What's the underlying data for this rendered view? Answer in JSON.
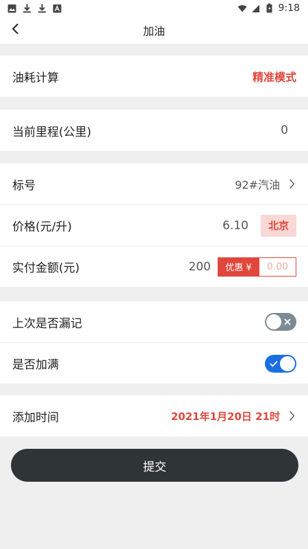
{
  "status_bar": {
    "time": "9:18",
    "left_icons": [
      "image-icon",
      "download-icon",
      "download-icon",
      "font-icon"
    ],
    "right_icons": [
      "wifi-icon",
      "signal-icon",
      "battery-icon"
    ]
  },
  "nav": {
    "title": "加油",
    "back_icon": "chevron-left-icon"
  },
  "consumption": {
    "label": "油耗计算",
    "mode": "精准模式"
  },
  "mileage": {
    "label": "当前里程(公里)",
    "value": "0"
  },
  "fuel": {
    "grade_label": "标号",
    "grade_value": "92#汽油",
    "price_label": "价格(元/升)",
    "price_value": "6.10",
    "city": "北京",
    "paid_label": "实付金额(元)",
    "paid_value": "200",
    "discount_tag": "优惠 ¥",
    "discount_placeholder": "0.00"
  },
  "flags": {
    "missed_label": "上次是否漏记",
    "missed_on": false,
    "full_label": "是否加满",
    "full_on": true
  },
  "time_row": {
    "label": "添加时间",
    "value": "2021年1月20日 21时"
  },
  "submit": {
    "label": "提交"
  },
  "colors": {
    "accent_red": "#e0473d",
    "toggle_on": "#1a6fe0",
    "toggle_off": "#7c8a93",
    "button_dark": "#2f3437"
  }
}
